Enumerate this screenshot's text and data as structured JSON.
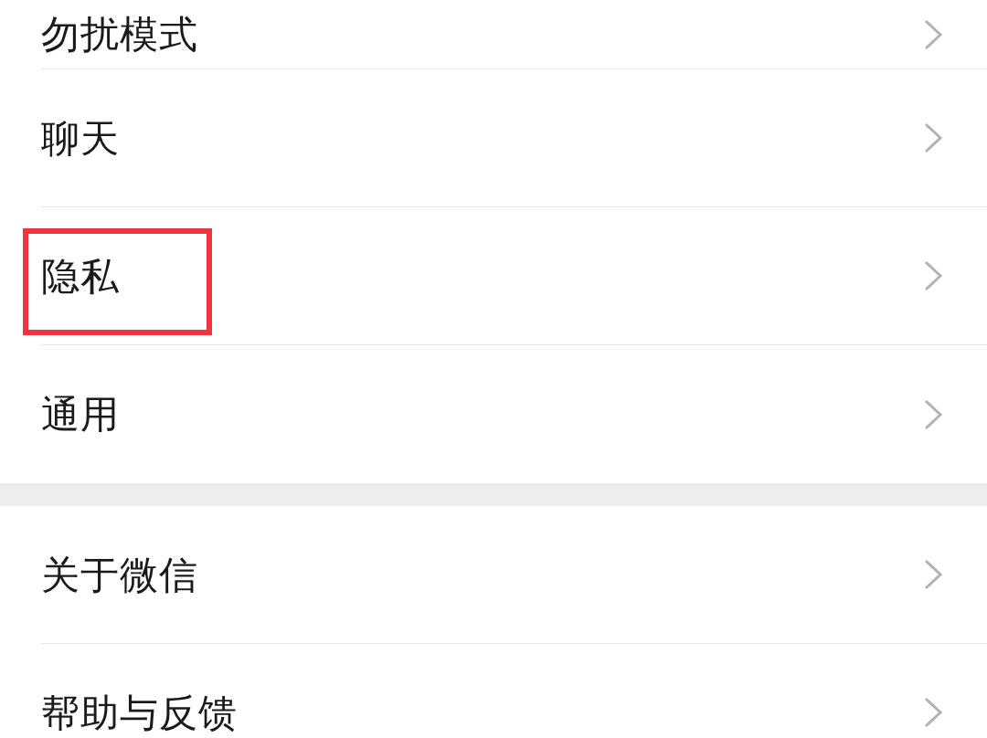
{
  "groups": [
    {
      "items": [
        {
          "label": "勿扰模式",
          "highlighted": false
        },
        {
          "label": "聊天",
          "highlighted": false
        },
        {
          "label": "隐私",
          "highlighted": true
        },
        {
          "label": "通用",
          "highlighted": false
        }
      ]
    },
    {
      "items": [
        {
          "label": "关于微信",
          "highlighted": false
        },
        {
          "label": "帮助与反馈",
          "highlighted": false
        }
      ]
    }
  ]
}
